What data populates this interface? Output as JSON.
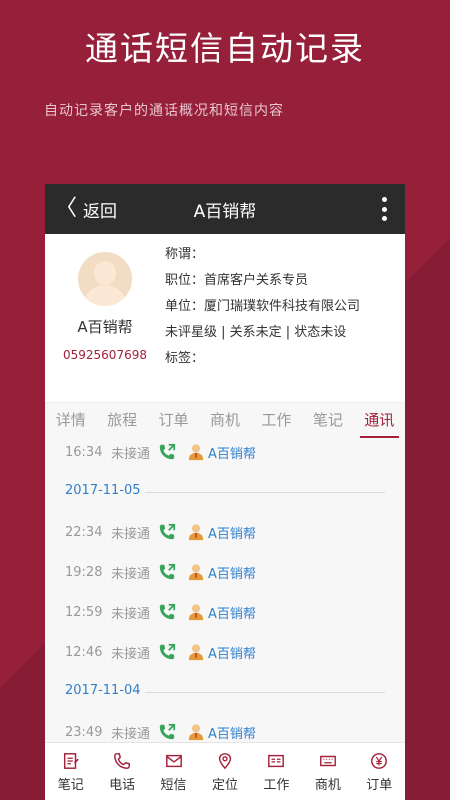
{
  "promo": {
    "title": "通话短信自动记录",
    "subtitle": "自动记录客户的通话概况和短信内容"
  },
  "appbar": {
    "back_label": "返回",
    "title": "A百销帮",
    "back_icon": "chevron-left-icon",
    "more_icon": "more-vertical-icon"
  },
  "profile": {
    "name": "A百销帮",
    "phone": "05925607698",
    "fields": [
      "称谓：",
      "职位：首席客户关系专员",
      "单位：厦门瑞璞软件科技有限公司",
      "未评星级 | 关系未定 | 状态未设",
      "标签："
    ]
  },
  "tabs": [
    {
      "label": "详情",
      "active": false
    },
    {
      "label": "旅程",
      "active": false
    },
    {
      "label": "订单",
      "active": false
    },
    {
      "label": "商机",
      "active": false
    },
    {
      "label": "工作",
      "active": false
    },
    {
      "label": "笔记",
      "active": false
    },
    {
      "label": "通讯",
      "active": true
    }
  ],
  "call_log": {
    "first": {
      "time": "16:34",
      "status": "未接通",
      "contact": "A百销帮"
    },
    "group1_date": "2017-11-05",
    "group1": [
      {
        "time": "22:34",
        "status": "未接通",
        "contact": "A百销帮"
      },
      {
        "time": "19:28",
        "status": "未接通",
        "contact": "A百销帮"
      },
      {
        "time": "12:59",
        "status": "未接通",
        "contact": "A百销帮"
      },
      {
        "time": "12:46",
        "status": "未接通",
        "contact": "A百销帮"
      }
    ],
    "group2_date": "2017-11-04",
    "group2": [
      {
        "time": "23:49",
        "status": "未接通",
        "contact": "A百销帮"
      }
    ]
  },
  "bottom_nav": [
    {
      "label": "笔记",
      "icon": "note-icon"
    },
    {
      "label": "电话",
      "icon": "phone-icon"
    },
    {
      "label": "短信",
      "icon": "mail-icon"
    },
    {
      "label": "定位",
      "icon": "location-icon"
    },
    {
      "label": "工作",
      "icon": "work-icon"
    },
    {
      "label": "商机",
      "icon": "keyboard-icon"
    },
    {
      "label": "订单",
      "icon": "yen-icon"
    }
  ],
  "colors": {
    "brand": "#96203a",
    "accent": "#a3203a",
    "link": "#2f7fcc",
    "call_icon": "#3aa35a"
  }
}
